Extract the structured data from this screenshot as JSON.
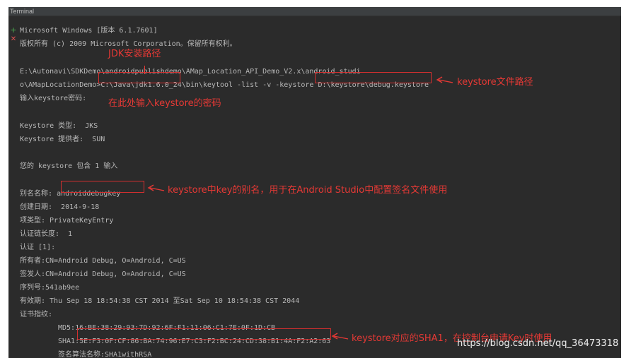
{
  "window": {
    "title": "Terminal"
  },
  "gutter": {
    "plus_icon": "plus-icon",
    "close_icon": "close-icon"
  },
  "console": {
    "line1": "Microsoft Windows [版本 6.1.7601]",
    "line2": "版权所有 (c) 2009 Microsoft Corporation。保留所有权利。",
    "line3": "E:\\Autonavi\\SDKDemo\\androidpublishdemo\\AMap_Location_API_Demo_V2.x\\android_studi",
    "line4_prefix": "o\\AMapLocationDemo>",
    "line4_jdk": "C:\\Java\\jdk1.6.0_24",
    "line4_mid": "\\bin\\keytool -list -v -keystore ",
    "line4_keystore": "D:\\keystore\\debug.keystore",
    "line5": "输入keystore密码:",
    "line6": "Keystore 类型:  JKS",
    "line7": "Keystore 提供者:  SUN",
    "line8": "您的 keystore 包含 1 输入",
    "alias_label": "别名名称:",
    "alias_value": "androiddebugkey",
    "line10": "创建日期:  2014-9-18",
    "line11": "项类型: PrivateKeyEntry",
    "line12": "认证链长度:  1",
    "line13": "认证 [1]:",
    "line14": "所有者:CN=Android Debug, O=Android, C=US",
    "line15": "签发人:CN=Android Debug, O=Android, C=US",
    "line16": "序列号:541ab9ee",
    "line17": "有效期: Thu Sep 18 18:54:38 CST 2014 至Sat Sep 10 18:54:38 CST 2044",
    "line18": "证书指纹:",
    "md5": "MD5:16:BE:38:29:93:7D:92:6F:F1:11:06:C1:7E:0F:1D:CB",
    "sha1_label": "SHA1:",
    "sha1_value": "5E:F3:0F:CF:86:BA:74:96:E7:C3:F2:BC:24:CD:38:B1:4A:F2:A2:63",
    "sig": "签名算法名称:SHA1withRSA"
  },
  "annotations": {
    "jdk_path": "JDK安装路径",
    "keystore_path": "keystore文件路径",
    "password_hint": "在此处输入keystore的密码",
    "alias_hint": "keystore中key的别名，用于在Android Studio中配置签名文件使用",
    "sha1_hint": "keystore对应的SHA1，在控制台申请Key时使用",
    "color": "#e53935"
  },
  "watermark": "https://blog.csdn.net/qq_36473318"
}
